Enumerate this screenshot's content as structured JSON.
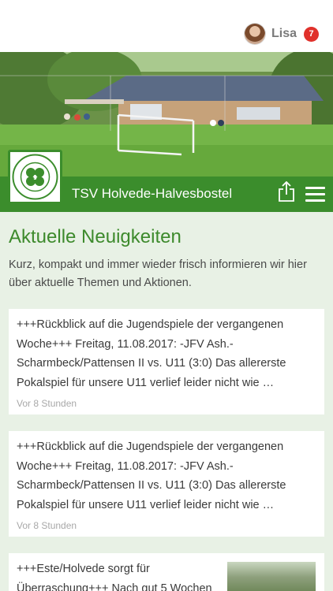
{
  "user": {
    "name": "Lisa",
    "badge_count": "7"
  },
  "club": {
    "title": "TSV Holvede-Halvesbostel",
    "logo_text_top": "TSV HOLVEDE",
    "logo_text_bottom": "HALVESBOSTEL e.V."
  },
  "news": {
    "title": "Aktuelle Neuigkeiten",
    "intro": "Kurz, kompakt und immer wieder frisch informieren wir hier über aktuelle Themen und Aktionen.",
    "items": [
      {
        "text": "+++Rückblick auf die Jugendspiele der vergangenen Woche+++ Freitag, 11.08.2017: -JFV Ash.-Scharmbeck/Pattensen II vs. U11 (3:0) Das allererste Pokalspiel für unsere U11 verlief leider nicht wie …",
        "time": "Vor 8 Stunden"
      },
      {
        "text": "+++Rückblick auf die Jugendspiele der vergangenen Woche+++ Freitag, 11.08.2017: -JFV Ash.-Scharmbeck/Pattensen II vs. U11 (3:0) Das allererste Pokalspiel für unsere U11 verlief leider nicht wie …",
        "time": "Vor 8 Stunden"
      },
      {
        "text": "+++Este/Holvede sorgt für Überraschung+++ Nach gut 5 Wochen"
      }
    ]
  },
  "icons": {
    "share": "share-icon",
    "menu": "hamburger-menu-icon"
  },
  "colors": {
    "brand_green": "#3b8d2c",
    "title_green": "#3d8a2c",
    "content_bg": "#e8f1e5",
    "badge_red": "#e0312b"
  }
}
